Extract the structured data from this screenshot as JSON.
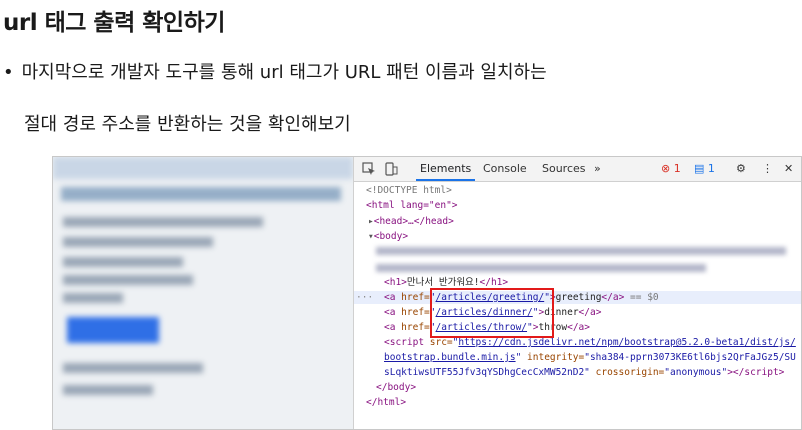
{
  "slide": {
    "title": "url 태그 출력 확인하기",
    "bullet_symbol": "•",
    "bullet_line1": "마지막으로 개발자 도구를 통해 url 태그가 URL 패턴 이름과 일치하는",
    "bullet_line2": "절대 경로 주소를 반환하는 것을 확인해보기"
  },
  "devtools": {
    "toolbar": {
      "inspect_icon": "inspect-element-icon",
      "device_icon": "device-toolbar-icon",
      "tabs": [
        "Elements",
        "Console",
        "Sources",
        "»"
      ],
      "error_count": "1",
      "message_count": "1",
      "settings_icon": "⚙",
      "more_icon": "⋮",
      "close_icon": "✕"
    },
    "code": {
      "doctype": "<!DOCTYPE html>",
      "html_open": "<html lang=\"en\">",
      "head": "<head>…</head>",
      "body_open": "<body>",
      "h1_open": "<h1>",
      "h1_text": "만나서 반가워요!",
      "h1_close": "</h1>",
      "ellipsis": "···",
      "links": [
        {
          "href": "/articles/greeting/",
          "text": "greeting",
          "suffix": "== $0"
        },
        {
          "href": "/articles/dinner/",
          "text": "dinner",
          "suffix": ""
        },
        {
          "href": "/articles/throw/",
          "text": "throw",
          "suffix": ""
        }
      ],
      "script_src_1": "https://cdn.jsdelivr.net/npm/bootstrap@5.2.0-beta1/dist/js/",
      "script_src_2": "bootstrap.bundle.min.js",
      "integrity_1": "\"sha384-pprn3073KE6tl6bjs2QrFaJGz5/SU",
      "integrity_2": "sLqktiwsUTF55Jfv3qYSDhgCecCxMW52nD2\"",
      "crossorigin": "\"anonymous\"",
      "body_close": "</body>",
      "html_close": "</html>"
    }
  }
}
